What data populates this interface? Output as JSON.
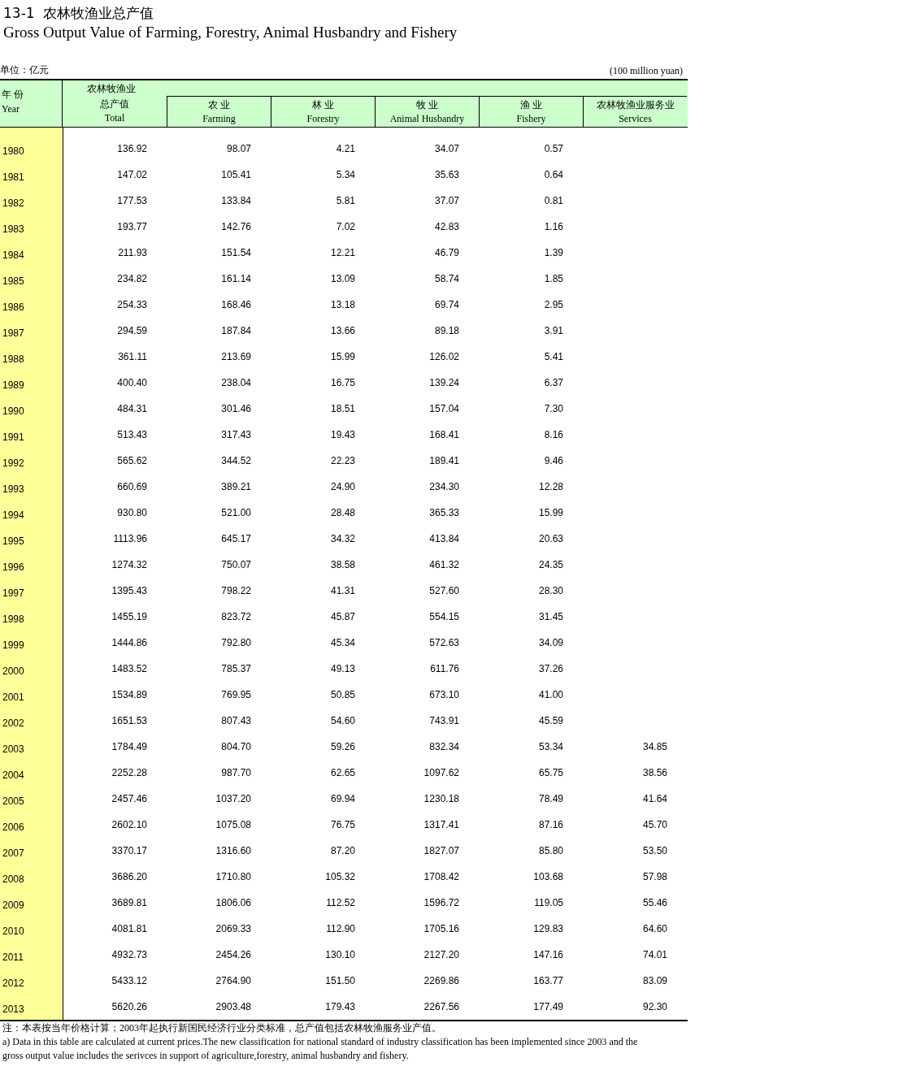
{
  "title": {
    "number": "13-1",
    "cn": "农林牧渔业总产值",
    "en": "Gross Output Value of Farming, Forestry, Animal Husbandry and Fishery"
  },
  "unit": {
    "cn": "单位：亿元",
    "en": "(100 million yuan)"
  },
  "year_header": {
    "cn": "年 份",
    "en": "Year"
  },
  "total_header": {
    "cn_top": "农林牧渔业",
    "cn": "总产值",
    "en": "Total"
  },
  "columns": [
    {
      "cn": "农 业",
      "en": "Farming"
    },
    {
      "cn": "林 业",
      "en": "Forestry"
    },
    {
      "cn": "牧 业",
      "en": "Animal Husbandry"
    },
    {
      "cn": "渔 业",
      "en": "Fishery"
    },
    {
      "cn": "农林牧渔业服务业",
      "en": "Services"
    }
  ],
  "rows": [
    {
      "year": "1980",
      "values": [
        "136.92",
        "98.07",
        "4.21",
        "34.07",
        "0.57"
      ]
    },
    {
      "year": "1981",
      "values": [
        "147.02",
        "105.41",
        "5.34",
        "35.63",
        "0.64"
      ]
    },
    {
      "year": "1982",
      "values": [
        "177.53",
        "133.84",
        "5.81",
        "37.07",
        "0.81"
      ]
    },
    {
      "year": "1983",
      "values": [
        "193.77",
        "142.76",
        "7.02",
        "42.83",
        "1.16"
      ]
    },
    {
      "year": "1984",
      "values": [
        "211.93",
        "151.54",
        "12.21",
        "46.79",
        "1.39"
      ]
    },
    {
      "year": "1985",
      "values": [
        "234.82",
        "161.14",
        "13.09",
        "58.74",
        "1.85"
      ]
    },
    {
      "year": "1986",
      "values": [
        "254.33",
        "168.46",
        "13.18",
        "69.74",
        "2.95"
      ]
    },
    {
      "year": "1987",
      "values": [
        "294.59",
        "187.84",
        "13.66",
        "89.18",
        "3.91"
      ]
    },
    {
      "year": "1988",
      "values": [
        "361.11",
        "213.69",
        "15.99",
        "126.02",
        "5.41"
      ]
    },
    {
      "year": "1989",
      "values": [
        "400.40",
        "238.04",
        "16.75",
        "139.24",
        "6.37"
      ]
    },
    {
      "year": "1990",
      "values": [
        "484.31",
        "301.46",
        "18.51",
        "157.04",
        "7.30"
      ]
    },
    {
      "year": "1991",
      "values": [
        "513.43",
        "317.43",
        "19.43",
        "168.41",
        "8.16"
      ]
    },
    {
      "year": "1992",
      "values": [
        "565.62",
        "344.52",
        "22.23",
        "189.41",
        "9.46"
      ]
    },
    {
      "year": "1993",
      "values": [
        "660.69",
        "389.21",
        "24.90",
        "234.30",
        "12.28"
      ]
    },
    {
      "year": "1994",
      "values": [
        "930.80",
        "521.00",
        "28.48",
        "365.33",
        "15.99"
      ]
    },
    {
      "year": "1995",
      "values": [
        "1113.96",
        "645.17",
        "34.32",
        "413.84",
        "20.63"
      ]
    },
    {
      "year": "1996",
      "values": [
        "1274.32",
        "750.07",
        "38.58",
        "461.32",
        "24.35"
      ]
    },
    {
      "year": "1997",
      "values": [
        "1395.43",
        "798.22",
        "41.31",
        "527.60",
        "28.30"
      ]
    },
    {
      "year": "1998",
      "values": [
        "1455.19",
        "823.72",
        "45.87",
        "554.15",
        "31.45"
      ]
    },
    {
      "year": "1999",
      "values": [
        "1444.86",
        "792.80",
        "45.34",
        "572.63",
        "34.09"
      ]
    },
    {
      "year": "2000",
      "values": [
        "1483.52",
        "785.37",
        "49.13",
        "611.76",
        "37.26"
      ]
    },
    {
      "year": "2001",
      "values": [
        "1534.89",
        "769.95",
        "50.85",
        "673.10",
        "41.00"
      ]
    },
    {
      "year": "2002",
      "values": [
        "1651.53",
        "807.43",
        "54.60",
        "743.91",
        "45.59"
      ]
    },
    {
      "year": "2003",
      "values": [
        "1784.49",
        "804.70",
        "59.26",
        "832.34",
        "53.34",
        "34.85"
      ]
    },
    {
      "year": "2004",
      "values": [
        "2252.28",
        "987.70",
        "62.65",
        "1097.62",
        "65.75",
        "38.56"
      ]
    },
    {
      "year": "2005",
      "values": [
        "2457.46",
        "1037.20",
        "69.94",
        "1230.18",
        "78.49",
        "41.64"
      ]
    },
    {
      "year": "2006",
      "values": [
        "2602.10",
        "1075.08",
        "76.75",
        "1317.41",
        "87.16",
        "45.70"
      ]
    },
    {
      "year": "2007",
      "values": [
        "3370.17",
        "1316.60",
        "87.20",
        "1827.07",
        "85.80",
        "53.50"
      ]
    },
    {
      "year": "2008",
      "values": [
        "3686.20",
        "1710.80",
        "105.32",
        "1708.42",
        "103.68",
        "57.98"
      ]
    },
    {
      "year": "2009",
      "values": [
        "3689.81",
        "1806.06",
        "112.52",
        "1596.72",
        "119.05",
        "55.46"
      ]
    },
    {
      "year": "2010",
      "values": [
        "4081.81",
        "2069.33",
        "112.90",
        "1705.16",
        "129.83",
        "64.60"
      ]
    },
    {
      "year": "2011",
      "values": [
        "4932.73",
        "2454.26",
        "130.10",
        "2127.20",
        "147.16",
        "74.01"
      ]
    },
    {
      "year": "2012",
      "values": [
        "5433.12",
        "2764.90",
        "151.50",
        "2269.86",
        "163.77",
        "83.09"
      ]
    },
    {
      "year": "2013",
      "values": [
        "5620.26",
        "2903.48",
        "179.43",
        "2267.56",
        "177.49",
        "92.30"
      ]
    }
  ],
  "notes": [
    "注：本表按当年价格计算；2003年起执行新国民经济行业分类标准，总产值包括农林牧渔服务业产值。",
    "a) Data in this table are calculated at current prices.The new classification for national standard of industry classification has been implemented since 2003 and the gross output value includes the serivces in support of agriculture,forestry, animal husbandry and fishery."
  ]
}
